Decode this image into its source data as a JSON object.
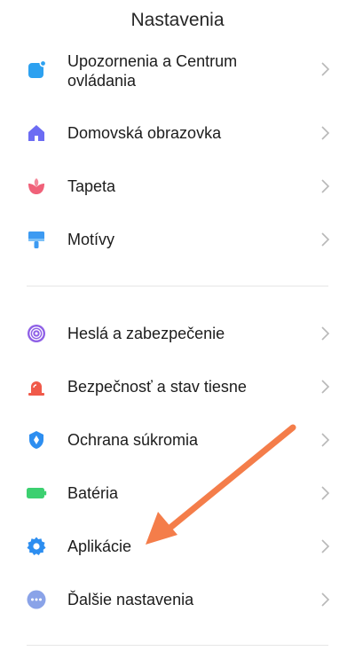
{
  "header": {
    "title": "Nastavenia"
  },
  "items": [
    {
      "label": "Upozornenia a Centrum ovládania",
      "icon": "notification-icon",
      "color": "#2da1f0"
    },
    {
      "label": "Domovská obrazovka",
      "icon": "home-icon",
      "color": "#6c6cf3"
    },
    {
      "label": "Tapeta",
      "icon": "wallpaper-flower-icon",
      "color": "#f06179"
    },
    {
      "label": "Motívy",
      "icon": "theme-brush-icon",
      "color": "#3c9af2"
    },
    {
      "label": "Heslá a zabezpečenie",
      "icon": "fingerprint-icon",
      "color": "#8e5fe6"
    },
    {
      "label": "Bezpečnosť a stav tiesne",
      "icon": "emergency-siren-icon",
      "color": "#f05a4a"
    },
    {
      "label": "Ochrana súkromia",
      "icon": "privacy-shield-icon",
      "color": "#2d8ef0"
    },
    {
      "label": "Batéria",
      "icon": "battery-icon",
      "color": "#3cd070"
    },
    {
      "label": "Aplikácie",
      "icon": "apps-gear-icon",
      "color": "#2d8ef0"
    },
    {
      "label": "Ďalšie nastavenia",
      "icon": "more-dots-icon",
      "color": "#8aa3e8"
    }
  ],
  "annotation": {
    "arrow_color": "#f47d4a",
    "icon": "arrow-pointer-icon"
  }
}
